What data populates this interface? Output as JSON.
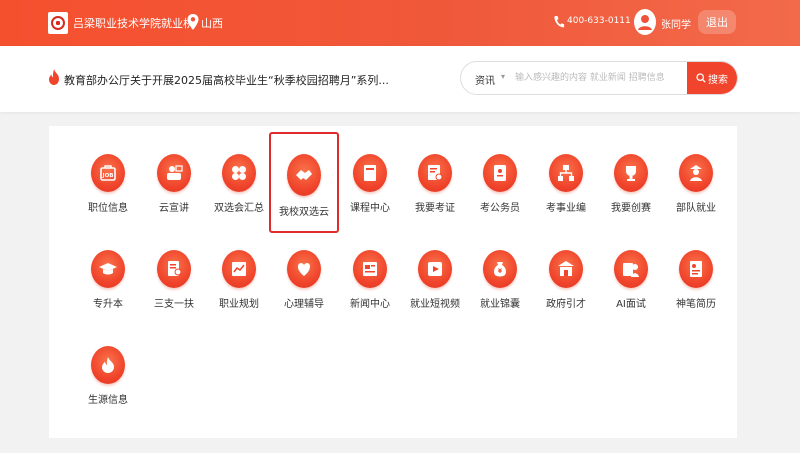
{
  "header": {
    "site_title": "吕梁职业技术学院就业桥",
    "location": "山西",
    "phone": "400-633-0111",
    "user_name": "张同学",
    "logout_label": "退出"
  },
  "news": {
    "text": "教育部办公厅关于开展2025届高校毕业生“秋季校园招聘月”系列..."
  },
  "search": {
    "category": "资讯",
    "placeholder": "输入感兴趣的内容 就业新闻 招聘信息",
    "button_label": "搜索"
  },
  "colors": {
    "brand": "#f0452c",
    "selected_outline": "#e02b2b"
  },
  "services": [
    {
      "label": "职位信息",
      "icon": "job-icon"
    },
    {
      "label": "云宣讲",
      "icon": "presenter-icon"
    },
    {
      "label": "双选会汇总",
      "icon": "four-leaf-icon"
    },
    {
      "label": "我校双选云",
      "icon": "handshake-icon",
      "selected": true
    },
    {
      "label": "课程中心",
      "icon": "book-icon"
    },
    {
      "label": "我要考证",
      "icon": "certificate-icon"
    },
    {
      "label": "考公务员",
      "icon": "id-card-icon"
    },
    {
      "label": "考事业编",
      "icon": "org-chart-icon"
    },
    {
      "label": "我要创赛",
      "icon": "trophy-icon"
    },
    {
      "label": "部队就业",
      "icon": "soldier-icon"
    },
    {
      "label": "专升本",
      "icon": "graduation-cap-icon"
    },
    {
      "label": "三支一扶",
      "icon": "document-person-icon"
    },
    {
      "label": "职业规划",
      "icon": "chart-icon"
    },
    {
      "label": "心理辅导",
      "icon": "heart-icon"
    },
    {
      "label": "新闻中心",
      "icon": "newspaper-icon"
    },
    {
      "label": "就业短视频",
      "icon": "video-icon"
    },
    {
      "label": "就业锦囊",
      "icon": "money-bag-icon"
    },
    {
      "label": "政府引才",
      "icon": "government-icon"
    },
    {
      "label": "AI面试",
      "icon": "interview-icon"
    },
    {
      "label": "神笔简历",
      "icon": "resume-icon"
    },
    {
      "label": "生源信息",
      "icon": "flame-icon"
    }
  ]
}
